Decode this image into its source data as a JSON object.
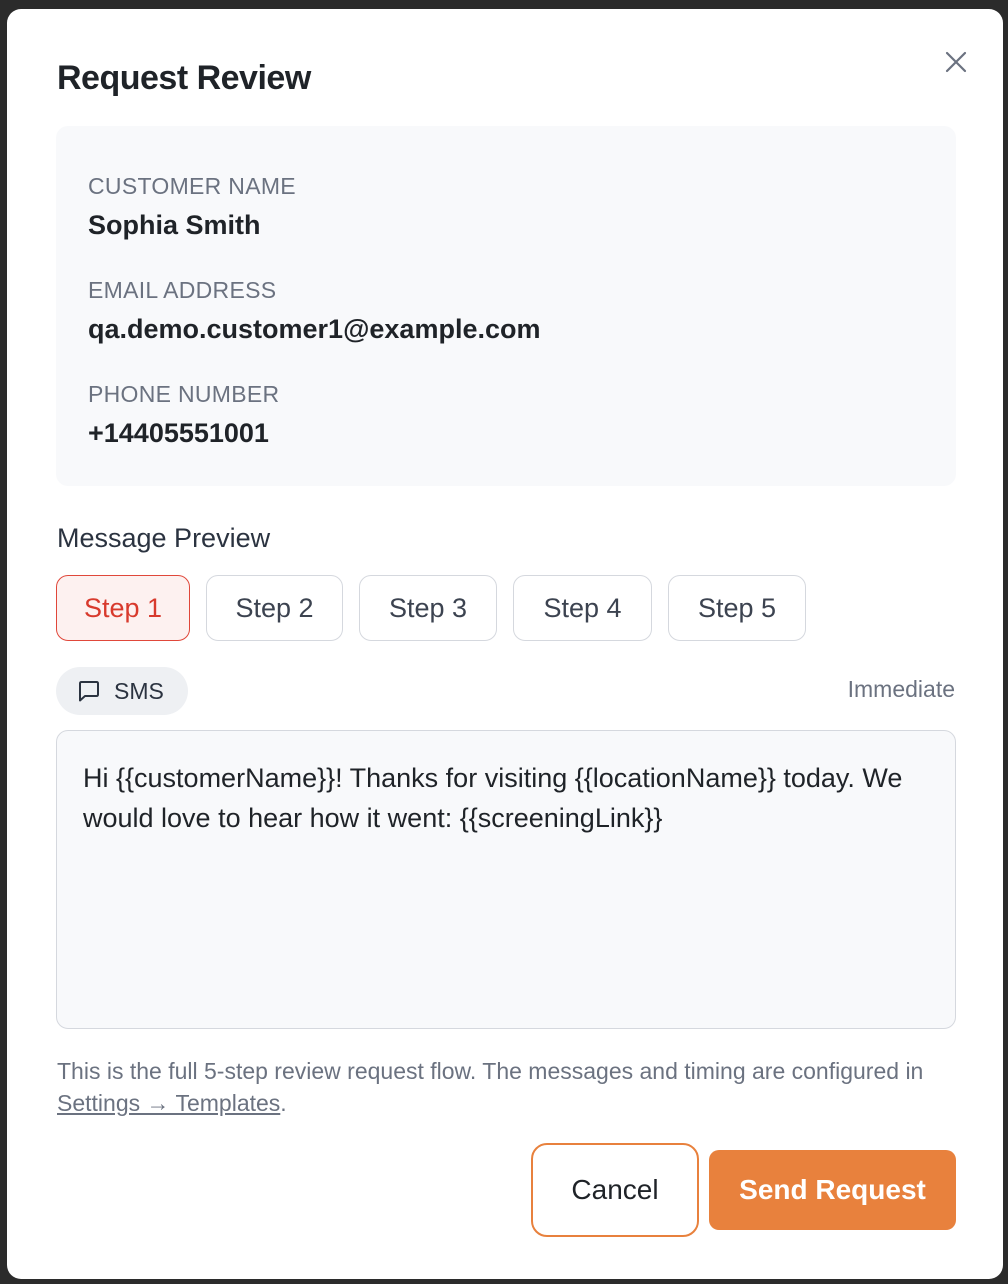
{
  "modal": {
    "title": "Request Review",
    "close_icon": "close-icon"
  },
  "customer": {
    "name_label": "CUSTOMER NAME",
    "name_value": "Sophia Smith",
    "email_label": "EMAIL ADDRESS",
    "email_value": "qa.demo.customer1@example.com",
    "phone_label": "PHONE NUMBER",
    "phone_value": "+14405551001"
  },
  "preview": {
    "section_title": "Message Preview",
    "steps": [
      {
        "label": "Step 1",
        "active": true
      },
      {
        "label": "Step 2",
        "active": false
      },
      {
        "label": "Step 3",
        "active": false
      },
      {
        "label": "Step 4",
        "active": false
      },
      {
        "label": "Step 5",
        "active": false
      }
    ],
    "channel": {
      "label": "SMS",
      "icon": "message-square-icon"
    },
    "timing": "Immediate",
    "message": "Hi {{customerName}}! Thanks for visiting {{locationName}} today. We would love to hear how it went: {{screeningLink}}"
  },
  "footnote": {
    "text_before": "This is the full 5-step review request flow. The messages and timing are configured in ",
    "link_text": "Settings → Templates",
    "text_after": "."
  },
  "actions": {
    "cancel_label": "Cancel",
    "send_label": "Send Request"
  },
  "colors": {
    "accent": "#e8813d",
    "active_step": "#d83a2d",
    "active_step_bg": "#fdf1f0"
  }
}
